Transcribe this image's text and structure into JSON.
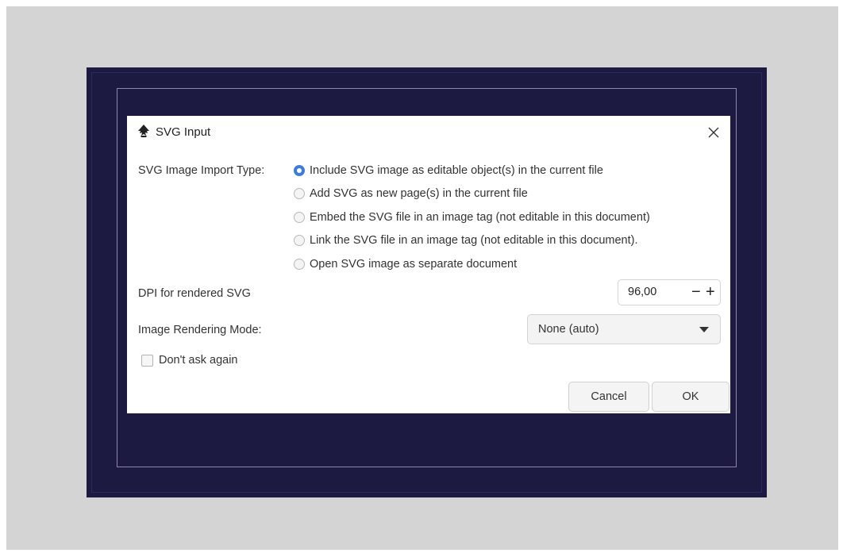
{
  "dialog": {
    "title": "SVG Input",
    "app_icon": "inkscape-logo-icon",
    "close_icon": "close-icon",
    "import_type_label": "SVG Image Import Type:",
    "import_options": [
      {
        "label": "Include SVG image as editable object(s) in the current file",
        "selected": true
      },
      {
        "label": "Add SVG as new page(s) in the current file",
        "selected": false
      },
      {
        "label": "Embed the SVG file in an image tag (not editable in this document)",
        "selected": false
      },
      {
        "label": "Link the SVG file in an image tag (not editable in this document).",
        "selected": false
      },
      {
        "label": "Open SVG image as separate document",
        "selected": false
      }
    ],
    "dpi_label": "DPI for rendered SVG",
    "dpi_value": "96,00",
    "dpi_minus": "−",
    "dpi_plus": "+",
    "rendering_mode_label": "Image Rendering Mode:",
    "rendering_mode_value": "None (auto)",
    "dont_ask_label": "Don't ask again",
    "dont_ask_checked": false,
    "cancel_label": "Cancel",
    "ok_label": "OK"
  },
  "colors": {
    "backdrop": "#d4d4d4",
    "frame": "#1d1a42",
    "accent": "#3b7dd8"
  }
}
